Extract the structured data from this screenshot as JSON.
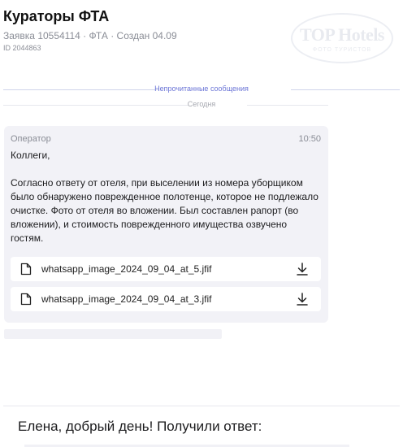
{
  "header": {
    "title": "Кураторы ФТА",
    "subtitle": "Заявка 10554114 · ФТА · Создан 04.09",
    "id_line": "ID 2044863",
    "logo": {
      "main": "TOP Hotels",
      "sub": "ФОТО ТУРИСТОВ"
    }
  },
  "dividers": {
    "unread": "Непрочитанные сообщения",
    "today": "Сегодня"
  },
  "message": {
    "sender": "Оператор",
    "time": "10:50",
    "greeting": "Коллеги,",
    "body": "Согласно ответу от отеля, при выселении из номера уборщиком было обнаружено поврежденное полотенце, которое не подлежало очистке. Фото от отеля во вложении. Был составлен рапорт (во вложении), и стоимость поврежденного имущества озвучено гостям.",
    "attachments": [
      {
        "name": "whatsapp_image_2024_09_04_at_5.jfif",
        "icon": "file-icon",
        "action_icon": "download-icon"
      },
      {
        "name": "whatsapp_image_2024_09_04_at_3.jfif",
        "icon": "file-icon",
        "action_icon": "download-icon"
      }
    ]
  },
  "reply": {
    "text": "Елена, добрый день! Получили ответ:"
  },
  "colors": {
    "accent": "#6a74d6",
    "bubble": "#f2f2f7",
    "muted": "#8a8d96"
  }
}
